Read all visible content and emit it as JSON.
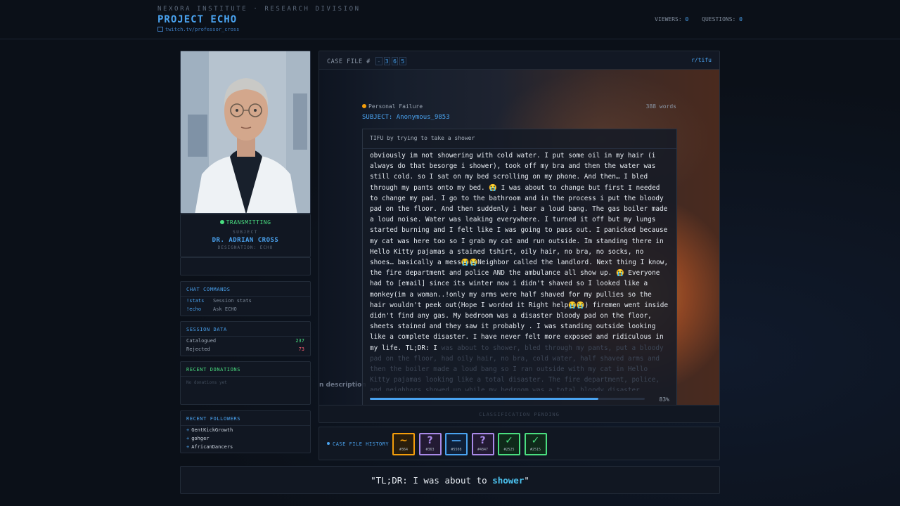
{
  "header": {
    "org": "NEXORA INSTITUTE · RESEARCH DIVISION",
    "project": "PROJECT ECHO",
    "channel": "twitch.tv/professor_cross",
    "viewers_label": "VIEWERS:",
    "viewers": "0",
    "questions_label": "QUESTIONS:",
    "questions": "0"
  },
  "subject_card": {
    "status": "TRANSMITTING",
    "label": "SUBJECT",
    "name": "DR. ADRIAN CROSS",
    "designation": "DESIGNATION: ECHO"
  },
  "chat_commands": {
    "title": "CHAT COMMANDS",
    "items": [
      {
        "cmd": "!stats",
        "desc": "Session stats"
      },
      {
        "cmd": "!echo",
        "desc": "Ask ECHO"
      }
    ]
  },
  "session_data": {
    "title": "SESSION DATA",
    "rows": [
      {
        "label": "Catalogued",
        "value": "237",
        "color": "#4ade80"
      },
      {
        "label": "Rejected",
        "value": "73",
        "color": "#f05a6e"
      }
    ]
  },
  "donations": {
    "title": "RECENT DONATIONS",
    "empty": "No donations yet"
  },
  "followers": {
    "title": "RECENT FOLLOWERS",
    "items": [
      "GentKickGrowth",
      "gohger",
      "AfricanDancers"
    ]
  },
  "case_file": {
    "label": "CASE FILE #",
    "digits": [
      "-",
      "3",
      "6",
      "5"
    ],
    "subreddit": "r/tifu",
    "category": "Personal Failure",
    "word_count": "388 words",
    "subject": "SUBJECT: Anonymous_9853",
    "title": "TIFU by trying to take a shower",
    "body": "obviously im not showering with cold water. I put some oil in my hair (i always do that besorge i shower), took off my bra and then the water was still cold. so I sat on my bed scrolling on my phone. And then… I bled through my pants onto my bed. 😭 I was about to change but first I needed to change my pad. I go to the bathroom and in the process i put the bloody pad on the floor. And then suddenly i hear a loud bang. The gas boiler made a loud noise. Water was leaking everywhere. I turned it off but my lungs started burning and I felt like I was going to pass out. I panicked because my cat was here too so I grab my cat and run outside. Im standing there in Hello Kitty pajamas a stained tshirt, oily hair, no bra, no socks, no shoes… basically a mess😭😭Neighbor called the landlord. Next thing I know, the fire department and police AND the ambulance all show up. 😭 Everyone had to [email] since its winter now i didn't shaved so I looked like a monkey(im a woman..!only my arms were half shaved for my pullies so the hair wouldn't peek out(Hope I worded it Right help😭😭) firemen went inside didn't find any gas. My bedroom was a disaster bloody pad on the floor, sheets stained and they saw it probably . I was standing outside looking like a complete disaster. I have never felt more exposed and ridiculous in my life. TL;DR: I",
    "body_ghost": " was about to shower, bled through my pants, put a bloody pad on the floor, had oily hair, no bra, cold water, half shaved arms and then the boiler made a loud bang so I ran outside with my cat in Hello Kitty pajamas looking like a total disaster. The fire department, police, and neighbors showed up while my bedroom was a total bloody disaster.",
    "progress": 0.83,
    "progress_label": "83%",
    "scene_caption": "n description",
    "classification": "CLASSIFICATION PENDING"
  },
  "history": {
    "label": "CASE FILE HISTORY",
    "tiles": [
      {
        "symbol": "~",
        "id": "#364",
        "color": "#f59e0b",
        "bg": "#2a1e0c"
      },
      {
        "symbol": "?",
        "id": "#363",
        "color": "#a98ae8",
        "bg": "#231a33"
      },
      {
        "symbol": "—",
        "id": "#5508",
        "color": "#4aa3f0",
        "bg": "#0f2038"
      },
      {
        "symbol": "?",
        "id": "#4847",
        "color": "#a98ae8",
        "bg": "#231a33"
      },
      {
        "symbol": "✓",
        "id": "#2525",
        "color": "#4ade80",
        "bg": "#0f2a1a"
      },
      {
        "symbol": "✓",
        "id": "#2515",
        "color": "#4ade80",
        "bg": "#0f2a1a"
      }
    ]
  },
  "quote": {
    "prefix": "\"TL;DR: I was about to ",
    "highlight": "shower",
    "suffix": "\""
  }
}
